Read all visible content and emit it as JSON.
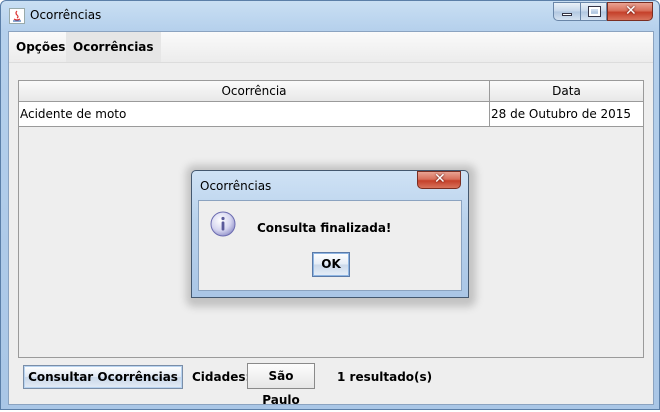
{
  "window": {
    "title": "Ocorrências"
  },
  "menu": {
    "items": [
      "Opções",
      "Ocorrências"
    ]
  },
  "table": {
    "columns": [
      "Ocorrência",
      "Data"
    ],
    "rows": [
      [
        "Acidente de moto",
        "28 de Outubro de 2015"
      ]
    ]
  },
  "footer": {
    "consult_button": "Consultar Ocorrências",
    "cities_label": "Cidades:",
    "city_selected": "São Paulo",
    "result_count": "1 resultado(s)"
  },
  "dialog": {
    "title": "Ocorrências",
    "message": "Consulta finalizada!",
    "ok_label": "OK",
    "icon": "info-icon"
  },
  "colors": {
    "titlebar": "#b5d0ec",
    "close_button": "#c5402a",
    "panel": "#eeeeee"
  }
}
